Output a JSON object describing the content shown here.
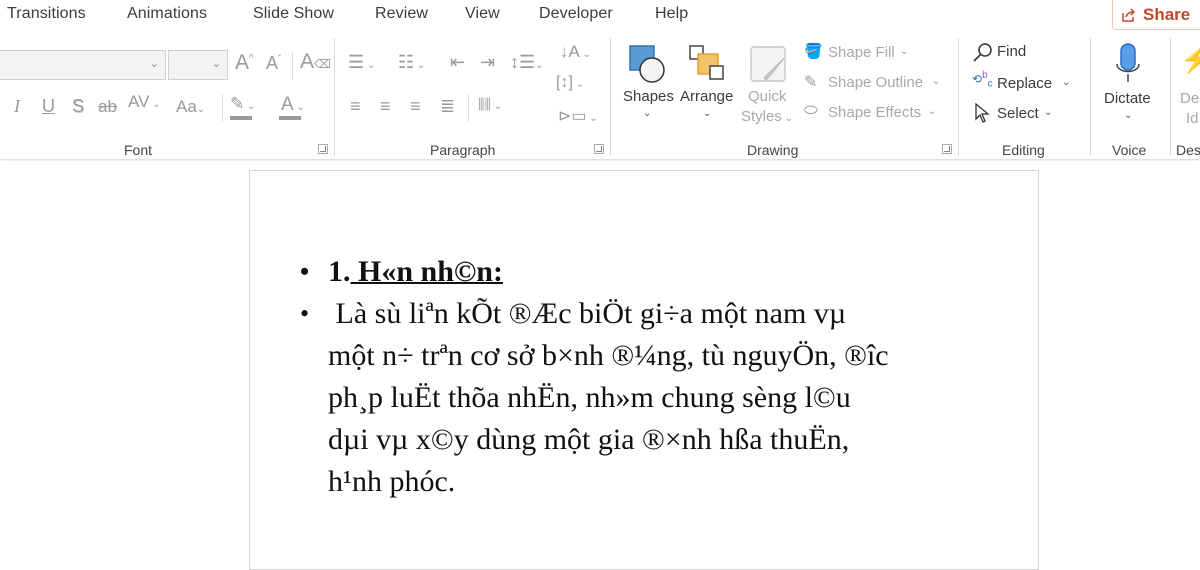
{
  "menubar": {
    "tabs": [
      "Transitions",
      "Animations",
      "Slide Show",
      "Review",
      "View",
      "Developer",
      "Help"
    ],
    "share_label": "Share"
  },
  "ribbon": {
    "font": {
      "group_label": "Font",
      "font_name_value": "",
      "font_size_value": "",
      "increase_font_label": "A",
      "decrease_font_label": "A",
      "italic_label": "I",
      "underline_label": "U",
      "shadow_label": "S",
      "strikethrough_label": "ab",
      "char_spacing_label": "AV",
      "change_case_label": "Aa",
      "font_color_label": "A"
    },
    "paragraph": {
      "group_label": "Paragraph"
    },
    "drawing": {
      "group_label": "Drawing",
      "shapes_label": "Shapes",
      "arrange_label": "Arrange",
      "quick_styles_label_1": "Quick",
      "quick_styles_label_2": "Styles",
      "shape_fill_label": "Shape Fill",
      "shape_outline_label": "Shape Outline",
      "shape_effects_label": "Shape Effects"
    },
    "editing": {
      "group_label": "Editing",
      "find_label": "Find",
      "replace_label": "Replace",
      "select_label": "Select"
    },
    "voice": {
      "group_label": "Voice",
      "dictate_label": "Dictate"
    },
    "designer": {
      "group_label": "Des",
      "design_ideas_label_1": "De",
      "design_ideas_label_2": "Id"
    }
  },
  "slide": {
    "heading_number": "1.",
    "heading_text": " H«n nh©n:",
    "body_lines": [
      " Là sù liªn kÕt ®Æc biÖt gi÷a một nam vµ",
      "một n÷ trªn cơ sở b×nh ®¼ng, tù nguyÖn, ®îc",
      "ph¸p luËt thõa nhËn, nh»m chung sèng l©u",
      "dµi vµ x©y dùng một gia ®×nh hßa thuËn,",
      "h¹nh phóc."
    ]
  },
  "colors": {
    "accent_share": "#c4472c",
    "mic_blue": "#4a90e2"
  }
}
